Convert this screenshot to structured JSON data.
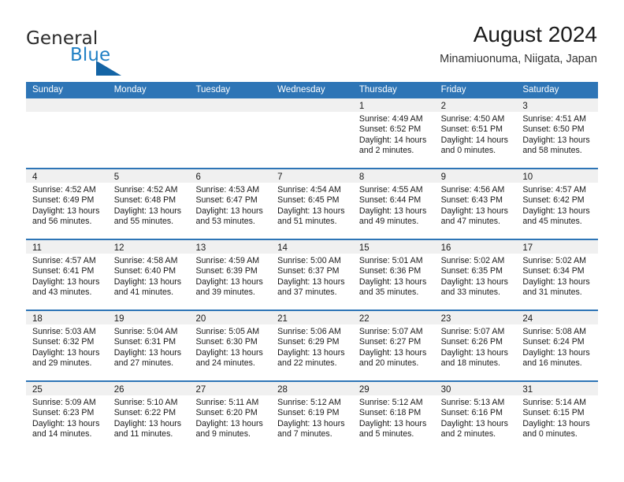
{
  "brand": {
    "name_part1": "General",
    "name_part2": "Blue",
    "accent_color": "#1f7fc4",
    "triangle_color": "#1464a5"
  },
  "header": {
    "title": "August 2024",
    "subtitle": "Minamiuonuma, Niigata, Japan"
  },
  "calendar": {
    "header_color": "#2e75b6",
    "day_band_color": "#f0f0f0",
    "weekdays": [
      "Sunday",
      "Monday",
      "Tuesday",
      "Wednesday",
      "Thursday",
      "Friday",
      "Saturday"
    ],
    "weeks": [
      [
        {
          "day": "",
          "empty": true
        },
        {
          "day": "",
          "empty": true
        },
        {
          "day": "",
          "empty": true
        },
        {
          "day": "",
          "empty": true
        },
        {
          "day": "1",
          "sunrise": "Sunrise: 4:49 AM",
          "sunset": "Sunset: 6:52 PM",
          "daylight1": "Daylight: 14 hours",
          "daylight2": "and 2 minutes."
        },
        {
          "day": "2",
          "sunrise": "Sunrise: 4:50 AM",
          "sunset": "Sunset: 6:51 PM",
          "daylight1": "Daylight: 14 hours",
          "daylight2": "and 0 minutes."
        },
        {
          "day": "3",
          "sunrise": "Sunrise: 4:51 AM",
          "sunset": "Sunset: 6:50 PM",
          "daylight1": "Daylight: 13 hours",
          "daylight2": "and 58 minutes."
        }
      ],
      [
        {
          "day": "4",
          "sunrise": "Sunrise: 4:52 AM",
          "sunset": "Sunset: 6:49 PM",
          "daylight1": "Daylight: 13 hours",
          "daylight2": "and 56 minutes."
        },
        {
          "day": "5",
          "sunrise": "Sunrise: 4:52 AM",
          "sunset": "Sunset: 6:48 PM",
          "daylight1": "Daylight: 13 hours",
          "daylight2": "and 55 minutes."
        },
        {
          "day": "6",
          "sunrise": "Sunrise: 4:53 AM",
          "sunset": "Sunset: 6:47 PM",
          "daylight1": "Daylight: 13 hours",
          "daylight2": "and 53 minutes."
        },
        {
          "day": "7",
          "sunrise": "Sunrise: 4:54 AM",
          "sunset": "Sunset: 6:45 PM",
          "daylight1": "Daylight: 13 hours",
          "daylight2": "and 51 minutes."
        },
        {
          "day": "8",
          "sunrise": "Sunrise: 4:55 AM",
          "sunset": "Sunset: 6:44 PM",
          "daylight1": "Daylight: 13 hours",
          "daylight2": "and 49 minutes."
        },
        {
          "day": "9",
          "sunrise": "Sunrise: 4:56 AM",
          "sunset": "Sunset: 6:43 PM",
          "daylight1": "Daylight: 13 hours",
          "daylight2": "and 47 minutes."
        },
        {
          "day": "10",
          "sunrise": "Sunrise: 4:57 AM",
          "sunset": "Sunset: 6:42 PM",
          "daylight1": "Daylight: 13 hours",
          "daylight2": "and 45 minutes."
        }
      ],
      [
        {
          "day": "11",
          "sunrise": "Sunrise: 4:57 AM",
          "sunset": "Sunset: 6:41 PM",
          "daylight1": "Daylight: 13 hours",
          "daylight2": "and 43 minutes."
        },
        {
          "day": "12",
          "sunrise": "Sunrise: 4:58 AM",
          "sunset": "Sunset: 6:40 PM",
          "daylight1": "Daylight: 13 hours",
          "daylight2": "and 41 minutes."
        },
        {
          "day": "13",
          "sunrise": "Sunrise: 4:59 AM",
          "sunset": "Sunset: 6:39 PM",
          "daylight1": "Daylight: 13 hours",
          "daylight2": "and 39 minutes."
        },
        {
          "day": "14",
          "sunrise": "Sunrise: 5:00 AM",
          "sunset": "Sunset: 6:37 PM",
          "daylight1": "Daylight: 13 hours",
          "daylight2": "and 37 minutes."
        },
        {
          "day": "15",
          "sunrise": "Sunrise: 5:01 AM",
          "sunset": "Sunset: 6:36 PM",
          "daylight1": "Daylight: 13 hours",
          "daylight2": "and 35 minutes."
        },
        {
          "day": "16",
          "sunrise": "Sunrise: 5:02 AM",
          "sunset": "Sunset: 6:35 PM",
          "daylight1": "Daylight: 13 hours",
          "daylight2": "and 33 minutes."
        },
        {
          "day": "17",
          "sunrise": "Sunrise: 5:02 AM",
          "sunset": "Sunset: 6:34 PM",
          "daylight1": "Daylight: 13 hours",
          "daylight2": "and 31 minutes."
        }
      ],
      [
        {
          "day": "18",
          "sunrise": "Sunrise: 5:03 AM",
          "sunset": "Sunset: 6:32 PM",
          "daylight1": "Daylight: 13 hours",
          "daylight2": "and 29 minutes."
        },
        {
          "day": "19",
          "sunrise": "Sunrise: 5:04 AM",
          "sunset": "Sunset: 6:31 PM",
          "daylight1": "Daylight: 13 hours",
          "daylight2": "and 27 minutes."
        },
        {
          "day": "20",
          "sunrise": "Sunrise: 5:05 AM",
          "sunset": "Sunset: 6:30 PM",
          "daylight1": "Daylight: 13 hours",
          "daylight2": "and 24 minutes."
        },
        {
          "day": "21",
          "sunrise": "Sunrise: 5:06 AM",
          "sunset": "Sunset: 6:29 PM",
          "daylight1": "Daylight: 13 hours",
          "daylight2": "and 22 minutes."
        },
        {
          "day": "22",
          "sunrise": "Sunrise: 5:07 AM",
          "sunset": "Sunset: 6:27 PM",
          "daylight1": "Daylight: 13 hours",
          "daylight2": "and 20 minutes."
        },
        {
          "day": "23",
          "sunrise": "Sunrise: 5:07 AM",
          "sunset": "Sunset: 6:26 PM",
          "daylight1": "Daylight: 13 hours",
          "daylight2": "and 18 minutes."
        },
        {
          "day": "24",
          "sunrise": "Sunrise: 5:08 AM",
          "sunset": "Sunset: 6:24 PM",
          "daylight1": "Daylight: 13 hours",
          "daylight2": "and 16 minutes."
        }
      ],
      [
        {
          "day": "25",
          "sunrise": "Sunrise: 5:09 AM",
          "sunset": "Sunset: 6:23 PM",
          "daylight1": "Daylight: 13 hours",
          "daylight2": "and 14 minutes."
        },
        {
          "day": "26",
          "sunrise": "Sunrise: 5:10 AM",
          "sunset": "Sunset: 6:22 PM",
          "daylight1": "Daylight: 13 hours",
          "daylight2": "and 11 minutes."
        },
        {
          "day": "27",
          "sunrise": "Sunrise: 5:11 AM",
          "sunset": "Sunset: 6:20 PM",
          "daylight1": "Daylight: 13 hours",
          "daylight2": "and 9 minutes."
        },
        {
          "day": "28",
          "sunrise": "Sunrise: 5:12 AM",
          "sunset": "Sunset: 6:19 PM",
          "daylight1": "Daylight: 13 hours",
          "daylight2": "and 7 minutes."
        },
        {
          "day": "29",
          "sunrise": "Sunrise: 5:12 AM",
          "sunset": "Sunset: 6:18 PM",
          "daylight1": "Daylight: 13 hours",
          "daylight2": "and 5 minutes."
        },
        {
          "day": "30",
          "sunrise": "Sunrise: 5:13 AM",
          "sunset": "Sunset: 6:16 PM",
          "daylight1": "Daylight: 13 hours",
          "daylight2": "and 2 minutes."
        },
        {
          "day": "31",
          "sunrise": "Sunrise: 5:14 AM",
          "sunset": "Sunset: 6:15 PM",
          "daylight1": "Daylight: 13 hours",
          "daylight2": "and 0 minutes."
        }
      ]
    ]
  }
}
